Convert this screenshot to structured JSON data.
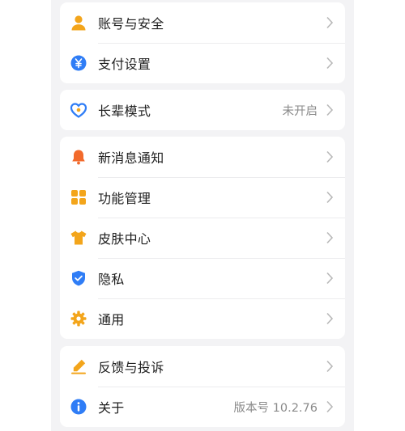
{
  "colors": {
    "orange": "#f3a51b",
    "blue": "#2f7df6",
    "red_orange": "#f26a2c",
    "chevron": "#b8b8b8"
  },
  "groups": [
    {
      "items": [
        {
          "label": "账号与安全",
          "value": "",
          "icon": "person-icon"
        },
        {
          "label": "支付设置",
          "value": "",
          "icon": "yen-icon"
        }
      ]
    },
    {
      "items": [
        {
          "label": "长辈模式",
          "value": "未开启",
          "icon": "heart-care-icon"
        }
      ]
    },
    {
      "items": [
        {
          "label": "新消息通知",
          "value": "",
          "icon": "bell-icon"
        },
        {
          "label": "功能管理",
          "value": "",
          "icon": "grid-icon"
        },
        {
          "label": "皮肤中心",
          "value": "",
          "icon": "tshirt-icon"
        },
        {
          "label": "隐私",
          "value": "",
          "icon": "shield-check-icon"
        },
        {
          "label": "通用",
          "value": "",
          "icon": "gear-icon"
        }
      ]
    },
    {
      "items": [
        {
          "label": "反馈与投诉",
          "value": "",
          "icon": "pen-icon"
        },
        {
          "label": "关于",
          "value": "版本号 10.2.76",
          "icon": "info-icon"
        }
      ]
    }
  ]
}
